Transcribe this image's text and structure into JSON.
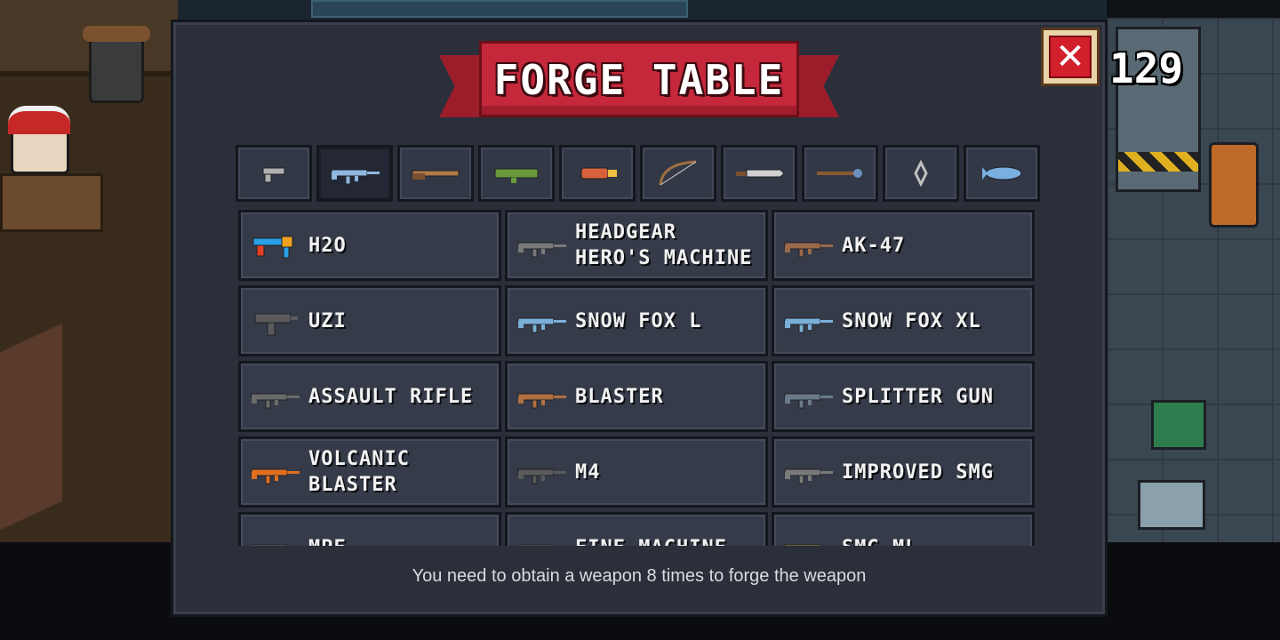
{
  "title": "FORGE TABLE",
  "close_label": "✕",
  "coins": "129",
  "tabs": [
    {
      "name": "tab-pistols",
      "icon": "pistol-icon",
      "color": "#b0b0b0"
    },
    {
      "name": "tab-rifles",
      "icon": "rifle-icon",
      "color": "#8fb7e0",
      "active": true
    },
    {
      "name": "tab-shotguns",
      "icon": "shotgun-icon",
      "color": "#b07a4a"
    },
    {
      "name": "tab-launchers",
      "icon": "rocket-launcher-icon",
      "color": "#6a9a3a"
    },
    {
      "name": "tab-special",
      "icon": "special-gun-icon",
      "color": "#d8603a"
    },
    {
      "name": "tab-bows",
      "icon": "bow-icon",
      "color": "#a07040"
    },
    {
      "name": "tab-melee",
      "icon": "blade-icon",
      "color": "#d0d0d0"
    },
    {
      "name": "tab-staffs",
      "icon": "staff-icon",
      "color": "#6a90c0"
    },
    {
      "name": "tab-throwables",
      "icon": "shuriken-icon",
      "color": "#c0c0c0"
    },
    {
      "name": "tab-misc",
      "icon": "fish-icon",
      "color": "#7ab0e0"
    }
  ],
  "weapons": [
    {
      "name": "H2O",
      "icon": "water-gun-icon",
      "color": "#2aa0e8"
    },
    {
      "name": "HEADGEAR\nHERO'S MACHINE",
      "icon": "rifle-icon",
      "color": "#7a7a7a"
    },
    {
      "name": "AK-47",
      "icon": "rifle-icon",
      "color": "#9a6a4a"
    },
    {
      "name": "UZI",
      "icon": "uzi-icon",
      "color": "#5a5a5a"
    },
    {
      "name": "SNOW FOX L",
      "icon": "rifle-icon",
      "color": "#7ab0d8"
    },
    {
      "name": "SNOW FOX XL",
      "icon": "rifle-icon",
      "color": "#7ab0d8"
    },
    {
      "name": "ASSAULT RIFLE",
      "icon": "rifle-icon",
      "color": "#6a6a6a"
    },
    {
      "name": "BLASTER",
      "icon": "rifle-icon",
      "color": "#b07040"
    },
    {
      "name": "SPLITTER GUN",
      "icon": "rifle-icon",
      "color": "#6a7a8a"
    },
    {
      "name": "VOLCANIC\nBLASTER",
      "icon": "rifle-icon",
      "color": "#e07020"
    },
    {
      "name": "M4",
      "icon": "rifle-icon",
      "color": "#5a5a5a"
    },
    {
      "name": "IMPROVED SMG",
      "icon": "rifle-icon",
      "color": "#7a7a7a"
    },
    {
      "name": "MPE",
      "icon": "rifle-icon",
      "color": "#7a7a7a"
    },
    {
      "name": "FINE MACHINE",
      "icon": "rifle-icon",
      "color": "#6a6a6a"
    },
    {
      "name": "SMG ML",
      "icon": "rifle-icon",
      "color": "#c0a040"
    }
  ],
  "hint": "You need to obtain a weapon 8 times to forge the weapon"
}
